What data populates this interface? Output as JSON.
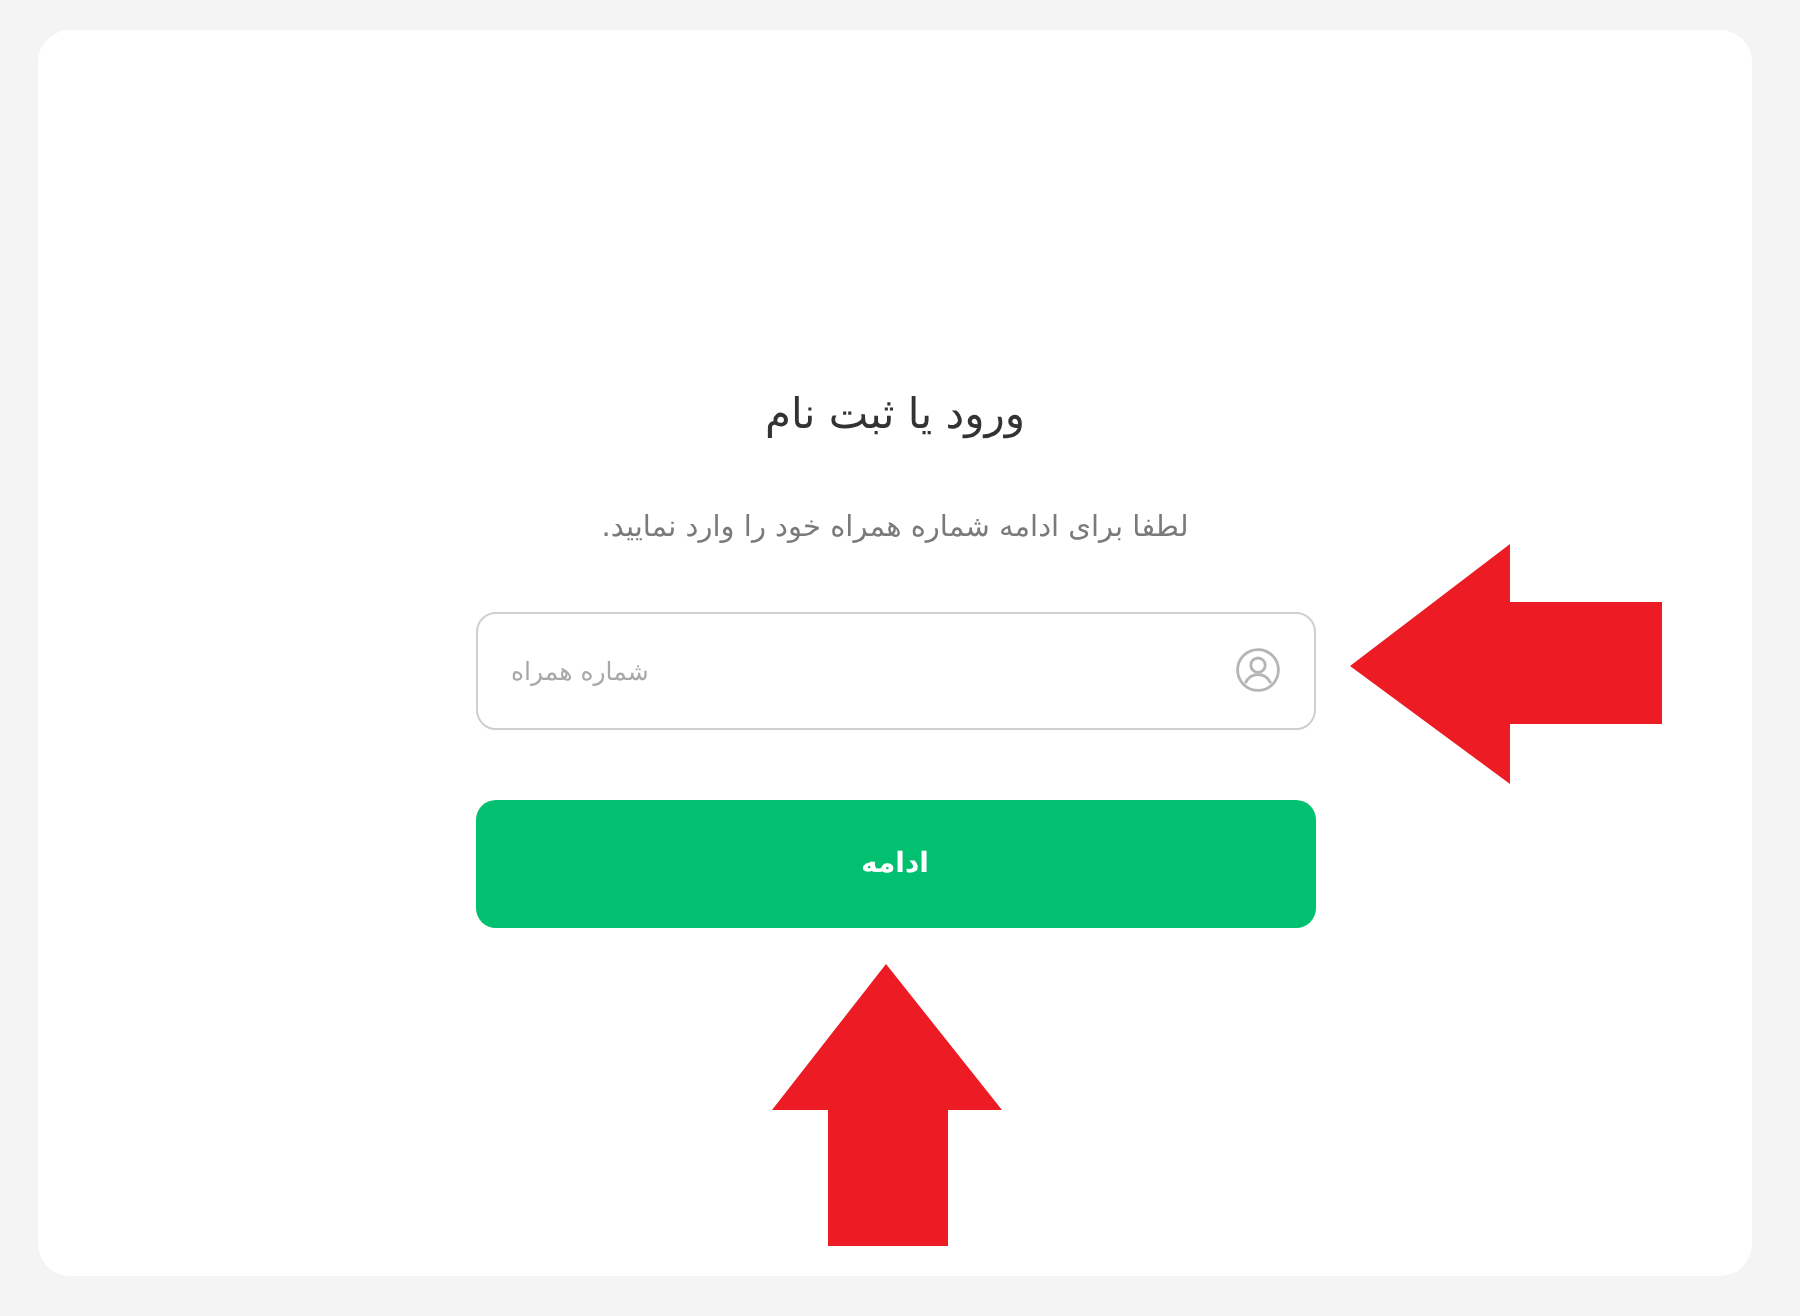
{
  "card": {
    "title": "ورود یا ثبت نام",
    "subtitle": "لطفا برای ادامه شماره همراه خود را وارد نمایید.",
    "phone_field": {
      "placeholder": "شماره همراه"
    },
    "continue_button": {
      "label": "ادامه"
    }
  }
}
